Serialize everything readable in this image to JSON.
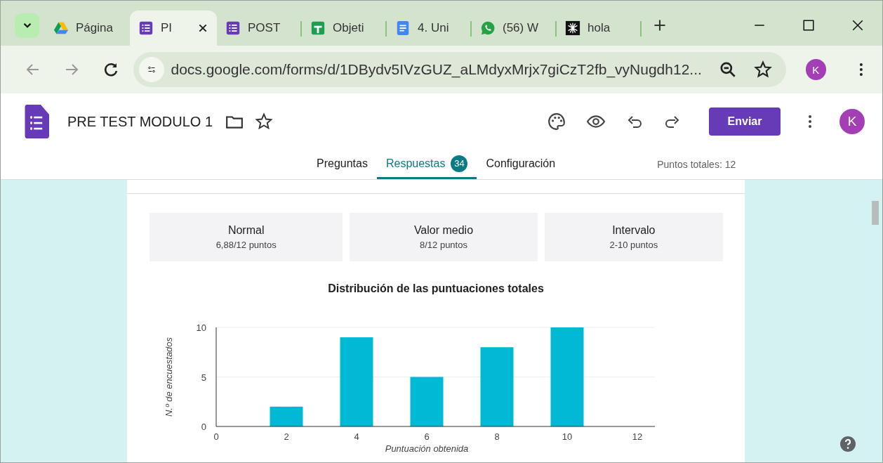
{
  "browser": {
    "tabs": [
      {
        "title": "Página",
        "kind": "drive",
        "selected": false
      },
      {
        "title": "PI",
        "kind": "forms",
        "selected": true
      },
      {
        "title": "POST",
        "kind": "forms",
        "selected": false
      },
      {
        "title": "Objeti",
        "kind": "sheets",
        "selected": false
      },
      {
        "title": "4. Uni",
        "kind": "docs",
        "selected": false
      },
      {
        "title": "(56) W",
        "kind": "chat",
        "selected": false
      },
      {
        "title": "hola",
        "kind": "dark",
        "selected": false
      }
    ],
    "address": "docs.google.com/forms/d/1DBydv5IVzGUZ_aLMdyxMrjx7giCzT2fb_vyNugdh12...",
    "profile": "K"
  },
  "form": {
    "title": "PRE TEST MODULO 1",
    "send_button": "Enviar",
    "avatar": "K",
    "tabs": [
      {
        "label": "Preguntas",
        "selected": false
      },
      {
        "label": "Respuestas",
        "selected": true,
        "badge": "34"
      },
      {
        "label": "Configuración",
        "selected": false
      }
    ],
    "total_points": "Puntos totales: 12"
  },
  "summary": [
    {
      "label": "Normal",
      "value": "6,88/12 puntos"
    },
    {
      "label": "Valor medio",
      "value": "8/12 puntos"
    },
    {
      "label": "Intervalo",
      "value": "2-10 puntos"
    }
  ],
  "chart_data": {
    "type": "bar",
    "title": "Distribución de las puntuaciones totales",
    "xlabel": "Puntuación obtenida",
    "ylabel": "N.º de encuestados",
    "x": [
      2,
      4,
      6,
      8,
      10
    ],
    "series": [
      {
        "color": "#00bad5",
        "values": [
          2,
          9,
          5,
          8,
          10
        ]
      }
    ],
    "xlim": [
      0,
      12.5
    ],
    "ylim": [
      0,
      10
    ],
    "xticks": [
      0,
      2,
      4,
      6,
      8,
      10,
      12
    ],
    "yticks": [
      0,
      5,
      10
    ]
  }
}
